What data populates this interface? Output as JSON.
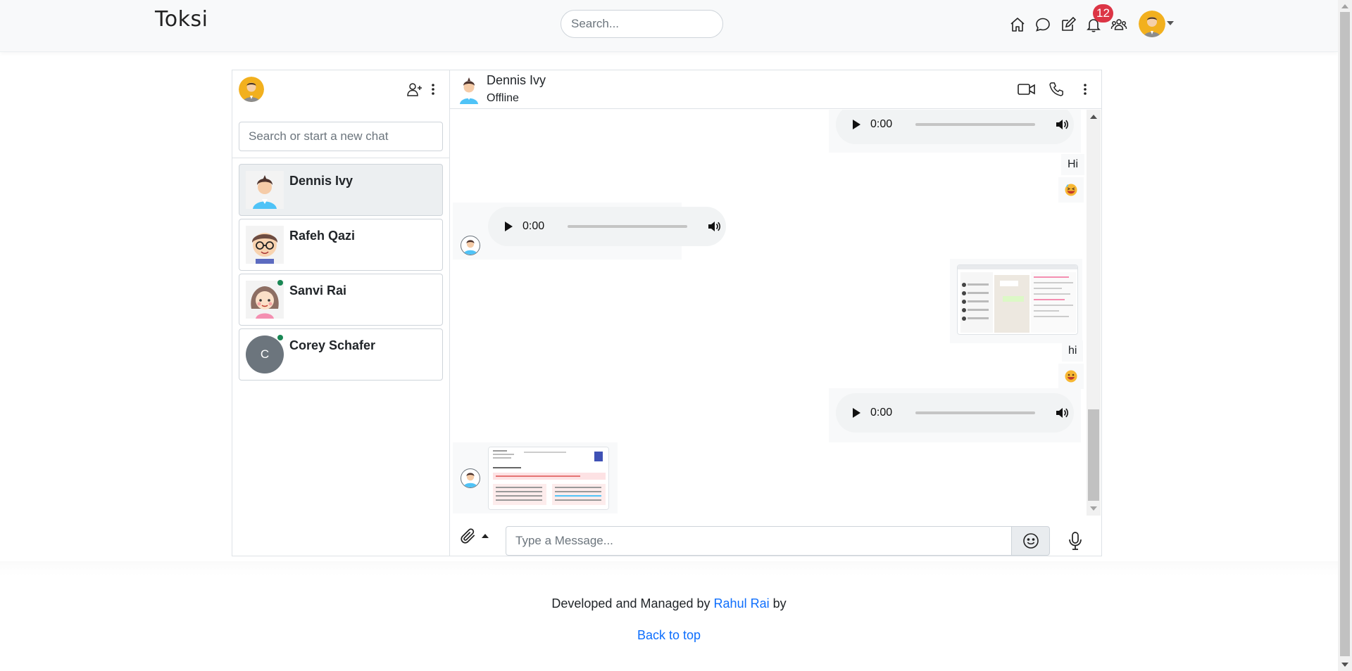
{
  "navbar": {
    "brand": "Toksi",
    "search_placeholder": "Search...",
    "icons": [
      "home-icon",
      "chat-icon",
      "edit-icon",
      "bell-icon",
      "people-icon"
    ],
    "notification_count": "12"
  },
  "sidebar": {
    "search_placeholder": "Search or start a new chat",
    "contacts": [
      {
        "name": "Dennis Ivy",
        "active": true,
        "online": false
      },
      {
        "name": "Rafeh Qazi",
        "active": false,
        "online": false
      },
      {
        "name": "Sanvi Rai",
        "active": false,
        "online": true
      },
      {
        "name": "Corey Schafer",
        "active": false,
        "online": true,
        "initial": "C"
      }
    ]
  },
  "chat": {
    "peer_name": "Dennis Ivy",
    "peer_status": "Offline",
    "messages": {
      "audio_time": "0:00",
      "text_hi_upper": "Hi",
      "text_hi_lower": "hi"
    },
    "input_placeholder": "Type a Message..."
  },
  "footer": {
    "prefix": "Developed and Managed by ",
    "author": "Rahul Rai",
    "suffix": " by",
    "back_to_top": "Back to top"
  },
  "colors": {
    "accent": "#0d6efd",
    "badge": "#dc3545",
    "online": "#198754",
    "active_contact": "#eceff1"
  }
}
